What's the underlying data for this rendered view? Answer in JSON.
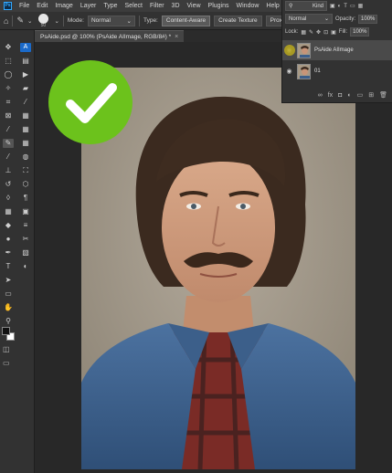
{
  "menu": {
    "app_icon": "Ps",
    "items": [
      "File",
      "Edit",
      "Image",
      "Layer",
      "Type",
      "Select",
      "Filter",
      "3D",
      "View",
      "Plugins",
      "Window",
      "Help"
    ]
  },
  "options": {
    "brush_size": "50",
    "mode_label": "Mode:",
    "mode_value": "Normal",
    "type_label": "Type:",
    "type_content_aware": "Content-Aware",
    "type_create_texture": "Create Texture",
    "type_proximity": "Proximit"
  },
  "tab": {
    "title": "PsAide.psd @ 100% (PsAide AIImage, RGB/8#) *",
    "close": "×"
  },
  "layers": {
    "kind_label": "Kind",
    "blend_mode": "Normal",
    "opacity_label": "Opacity:",
    "opacity_value": "100%",
    "lock_label": "Lock:",
    "fill_label": "Fill:",
    "fill_value": "100%",
    "items": [
      {
        "name": "PsAide AIImage",
        "selected": true
      },
      {
        "name": "01",
        "selected": false
      }
    ]
  },
  "colors": {
    "accent_green": "#6cc21c",
    "ps_blue": "#31a8ff",
    "panel_bg": "#323232",
    "menubar_bg": "#3c3c3c"
  },
  "icons": {
    "home": "home-icon",
    "brush": "healing-brush-icon",
    "checkmark": "checkmark-icon"
  }
}
